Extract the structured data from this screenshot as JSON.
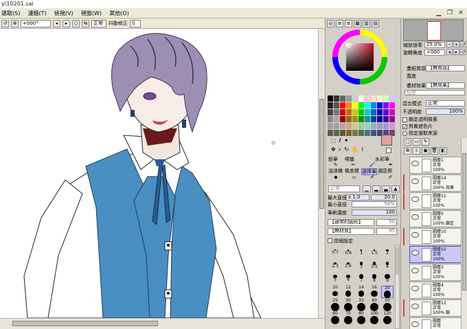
{
  "window": {
    "title": "y\\10201.sai"
  },
  "menu": [
    "選取(S)",
    "濾鏡(T)",
    "檢視(V)",
    "視窗(W)",
    "其他(O)"
  ],
  "toolbar": {
    "angle": "+000°",
    "mode": "正常",
    "stabilizer_label": "抖動修正",
    "stabilizer_value": "0"
  },
  "navigator": {
    "zoom_label": "縮放倍率",
    "zoom_value": "25.0%",
    "rotate_label": "旋轉角度",
    "rotate_value": "+000"
  },
  "paper": {
    "texture_label": "畫紙質感",
    "texture_value": "【無質感】",
    "effect_label": "畫材效果",
    "effect_value": "【無效果】",
    "degree_label": "程度",
    "width_label": "寬度"
  },
  "layer_settings": {
    "blend_label": "混合模式",
    "blend_value": "正常",
    "opacity_label": "不透明度",
    "opacity_value": "100%",
    "lock_alpha": "鎖定透明像素",
    "clipping": "剪裁遮色片",
    "selection_source": "指定選取來源"
  },
  "tools": {
    "row1": [
      "鉛筆",
      "噴槍",
      "水彩筆"
    ],
    "row2": [
      "油漆桶",
      "橡皮擦",
      "選擇筆",
      "選區擦"
    ]
  },
  "brush": {
    "mode": "正常",
    "max_size_label": "最大直徑",
    "max_size_mult": "x 1.0",
    "max_size_value": "20.0",
    "min_size_label": "最小直徑",
    "min_size_value": "50%",
    "density_label": "筆刷濃度",
    "density_value": "100",
    "shape": "【通常的圓形】",
    "shape_value": "50",
    "texture": "【無材質】",
    "texture_value": "95",
    "detail_label": "詳細設定"
  },
  "brush_sizes": [
    "0.7",
    "0.8",
    "1",
    "1.5",
    "2",
    "2.3",
    "2.6",
    "3",
    "3.5",
    "4",
    "5",
    "6",
    "7",
    "8",
    "9",
    "10",
    "12",
    "14",
    "16",
    "20",
    "25",
    "30",
    "35",
    "40",
    "50",
    "60",
    "70",
    "80",
    "100",
    "120"
  ],
  "layers": [
    {
      "name": "圖層1",
      "mode": "正常",
      "opacity": "100%"
    },
    {
      "name": "圖層14",
      "mode": "正常",
      "opacity": "100%",
      "extra": "效果"
    },
    {
      "name": "圖層11",
      "mode": "正常",
      "opacity": "100%"
    },
    {
      "name": "圖層5",
      "mode": "正常",
      "opacity": "100%",
      "extra": "鎖定"
    },
    {
      "name": "圖層10",
      "mode": "正常",
      "opacity": "100%"
    },
    {
      "name": "圖層15",
      "mode": "正常",
      "opacity": "100%"
    },
    {
      "name": "圖層3",
      "mode": "正常",
      "opacity": "100%"
    },
    {
      "name": "圖層4",
      "mode": "正常",
      "opacity": "100%"
    },
    {
      "name": "圖層12",
      "mode": "正常",
      "opacity": "100%",
      "extra": "鎖"
    },
    {
      "name": "圖層",
      "mode": "正常",
      "opacity": ""
    }
  ],
  "colors": {
    "accent": "#4a90c0",
    "hair": "#9d8fb4",
    "vest": "#4a8fc2",
    "selection": "#c9c8f6"
  }
}
